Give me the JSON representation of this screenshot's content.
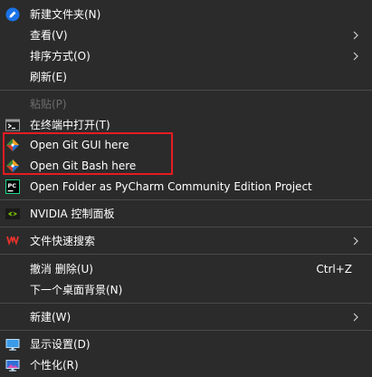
{
  "menu": {
    "items": [
      {
        "label": "新建文件夹(N)",
        "icon": "new-folder-icon"
      },
      {
        "label": "查看(V)",
        "submenu": true
      },
      {
        "label": "排序方式(O)",
        "submenu": true
      },
      {
        "label": "刷新(E)"
      },
      {
        "label": "粘贴(P)",
        "disabled": true
      },
      {
        "label": "在终端中打开(T)",
        "icon": "terminal-icon"
      },
      {
        "label": "Open Git GUI here",
        "icon": "git-gui-icon"
      },
      {
        "label": "Open Git Bash here",
        "icon": "git-bash-icon"
      },
      {
        "label": "Open Folder as PyCharm Community Edition Project",
        "icon": "pycharm-icon"
      },
      {
        "label": "NVIDIA 控制面板",
        "icon": "nvidia-icon"
      },
      {
        "label": "文件快速搜索",
        "icon": "wps-icon",
        "submenu": true
      },
      {
        "label": "撤消 删除(U)",
        "shortcut": "Ctrl+Z"
      },
      {
        "label": "下一个桌面背景(N)"
      },
      {
        "label": "新建(W)",
        "submenu": true
      },
      {
        "label": "显示设置(D)",
        "icon": "display-settings-icon"
      },
      {
        "label": "个性化(R)",
        "icon": "personalize-icon"
      }
    ]
  },
  "colors": {
    "background": "#2b2b2b",
    "separator": "#4a4a4a",
    "highlight_border": "#e51c23",
    "disabled_text": "#6d6d6d"
  }
}
